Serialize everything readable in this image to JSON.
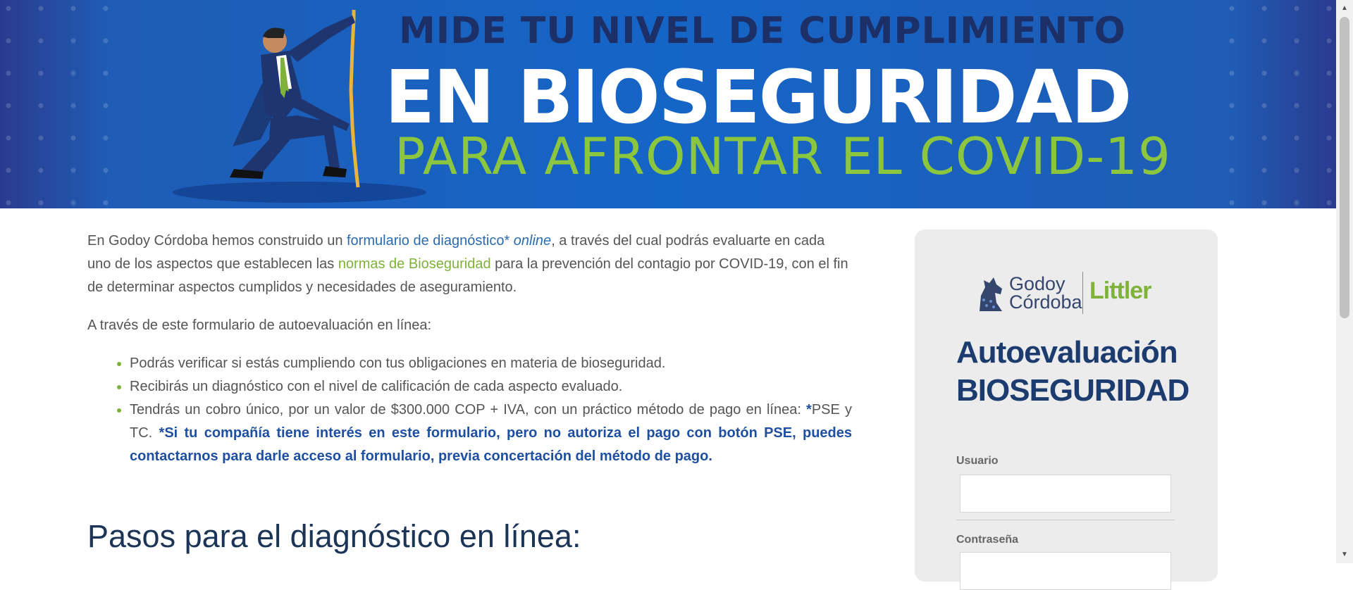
{
  "banner": {
    "line1": "MIDE TU NIVEL DE CUMPLIMIENTO",
    "line2": "EN BIOSEGURIDAD",
    "line3": "PARA AFRONTAR EL COVID-19",
    "colors": {
      "background": "#1565c7",
      "dark_text": "#1c2f66",
      "green": "#8cc63f"
    }
  },
  "intro": {
    "p1_before": "En Godoy Córdoba hemos construido un ",
    "p1_link": "formulario de diagnóstico* ",
    "p1_link_italic": "online",
    "p1_middle": ", a través del cual podrás evaluarte en cada uno de los aspectos que establecen las ",
    "p1_link2": "normas de Bioseguridad",
    "p1_after": " para la prevención del contagio por COVID-19, con el fin de determinar aspectos cumplidos y necesidades de aseguramiento.",
    "p2": "A través de este formulario de autoevaluación en línea:",
    "bullets": [
      "Podrás verificar si estás cumpliendo con tus obligaciones en materia de bioseguridad.",
      "Recibirás un diagnóstico con el nivel de calificación de cada aspecto evaluado."
    ],
    "bullet3_text": "Tendrás un cobro único, por un valor de $300.000 COP + IVA, con un práctico método de pago en línea: ",
    "bullet3_star": "*",
    "bullet3_text2": "PSE y TC. ",
    "bullet3_bold": "*Si tu compañía tiene interés en este formulario, pero no autoriza el pago con botón PSE, puedes contactarnos para darle acceso al formulario, previa concertación del método de pago."
  },
  "steps_heading": "Pasos para el diagnóstico en línea:",
  "login": {
    "logo_godoy_line1": "Godoy",
    "logo_godoy_line2": "Córdoba",
    "logo_littler": "Littler",
    "title_line1": "Autoevaluación",
    "title_line2": "BIOSEGURIDAD",
    "username_label": "Usuario",
    "password_label": "Contraseña"
  }
}
